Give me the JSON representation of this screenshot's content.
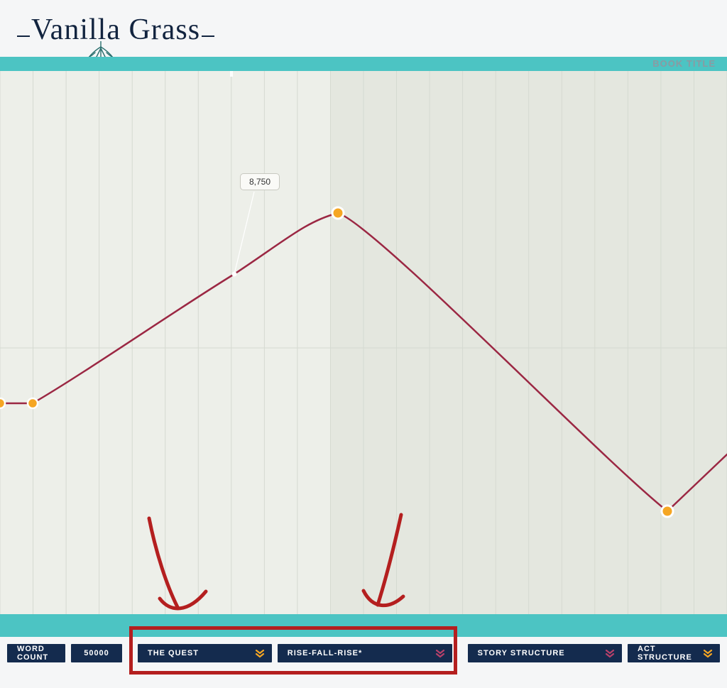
{
  "brand": {
    "name": "Vanilla Grass"
  },
  "header": {
    "book_title_label": "BOOK TITLE"
  },
  "tooltip": {
    "value": "8,750"
  },
  "bottom": {
    "word_count_label": "WORD COUNT",
    "word_count_value": "50000",
    "dropdown_plot": "THE QUEST",
    "dropdown_shape": "RISE-FALL-RISE*",
    "dropdown_story_structure": "STORY STRUCTURE",
    "dropdown_act_structure": "ACT STRUCTURE"
  },
  "colors": {
    "teal": "#4cc4c3",
    "navy": "#142b4e",
    "line": "#9b2743",
    "marker": "#f5a623",
    "chevron_orange": "#f5a623",
    "chevron_pink": "#b8406a",
    "annotation": "#b41f1f"
  },
  "chart_data": {
    "type": "line",
    "title": "",
    "xlabel": "",
    "ylabel": "",
    "xlim": [
      0,
      1024
    ],
    "ylim": [
      0,
      765
    ],
    "grid": {
      "columns": 22,
      "shaded_from_col": 10,
      "shaded_to_col": 22
    },
    "series": [
      {
        "name": "story-arc",
        "points": [
          {
            "x": 0,
            "y": 468,
            "marker": true
          },
          {
            "x": 46,
            "y": 468,
            "marker": true
          },
          {
            "x": 330,
            "y": 286,
            "marker": false,
            "mid": true
          },
          {
            "x": 476,
            "y": 200,
            "marker": true
          },
          {
            "x": 940,
            "y": 620,
            "marker": true
          },
          {
            "x": 1024,
            "y": 540,
            "marker": false
          }
        ]
      }
    ],
    "tooltip": {
      "label": "8,750",
      "attached_to_point_index": 2
    }
  }
}
